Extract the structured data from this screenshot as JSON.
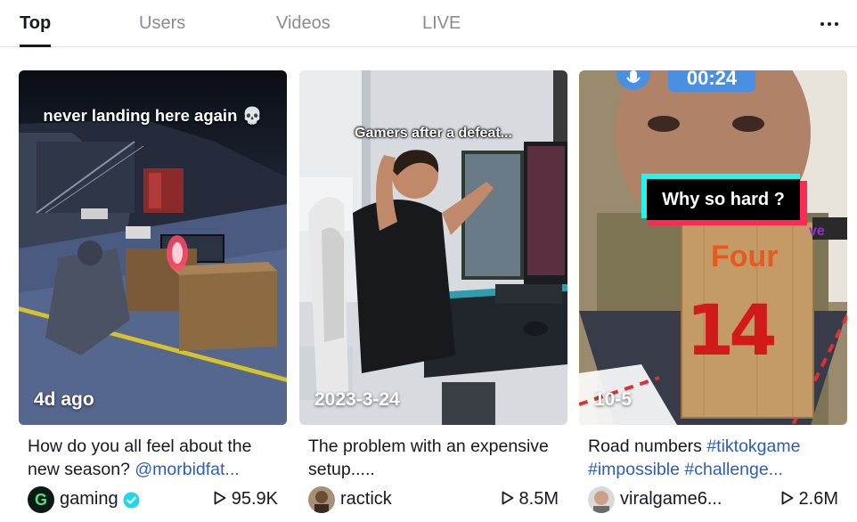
{
  "tabs": [
    {
      "label": "Top",
      "active": true
    },
    {
      "label": "Users",
      "active": false
    },
    {
      "label": "Videos",
      "active": false
    },
    {
      "label": "LIVE",
      "active": false
    }
  ],
  "more_icon": "more-horizontal-icon",
  "accent_link_color": "#2b5db9",
  "videos": [
    {
      "overlay_text": "never landing here again 💀",
      "date": "4d ago",
      "description": "How do you all feel about the new season? ",
      "description_tag": "@morbidfat...",
      "author": "gaming",
      "verified": true,
      "views": "95.9K",
      "avatar_letter": "G"
    },
    {
      "overlay_text": "Gamers after a defeat...",
      "date": "2023-3-24",
      "description": "The problem with an expensive setup.....",
      "author": "ractick",
      "verified": false,
      "views": "8.5M"
    },
    {
      "overlay_timer": "00:24",
      "overlay_text": "Why so hard ?",
      "overlay_sign_text": "Four",
      "overlay_digits": "14",
      "date": "10-5",
      "description": "Road numbers ",
      "description_tags": "#tiktokgame #impossible #challenge...",
      "author": "viralgame6...",
      "verified": false,
      "views": "2.6M"
    }
  ]
}
